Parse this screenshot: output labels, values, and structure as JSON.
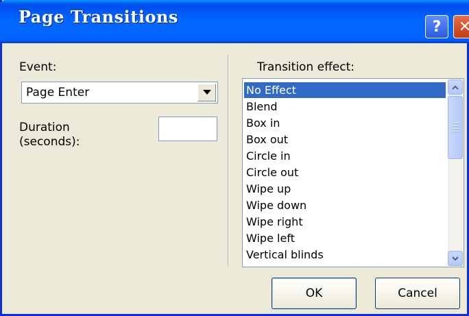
{
  "window": {
    "title": "Page Transitions",
    "help_button": "?",
    "close_button": "✕"
  },
  "left_panel": {
    "event_label": "Event:",
    "event_value": "Page Enter",
    "duration_label": "Duration\n(seconds):",
    "duration_value": ""
  },
  "right_panel": {
    "transition_label": "Transition effect:",
    "items": [
      "No Effect",
      "Blend",
      "Box in",
      "Box out",
      "Circle in",
      "Circle out",
      "Wipe up",
      "Wipe down",
      "Wipe right",
      "Wipe left",
      "Vertical blinds"
    ],
    "selected": "No Effect"
  },
  "buttons": {
    "ok": "OK",
    "cancel": "Cancel"
  },
  "icons": {
    "combo_arrow": "chevron-down-icon",
    "scroll_up": "chevron-up-icon",
    "scroll_down": "chevron-down-icon"
  },
  "colors": {
    "titlebar": "#0058ee",
    "selection": "#316ac5",
    "dialog_bg": "#ece9d8"
  }
}
